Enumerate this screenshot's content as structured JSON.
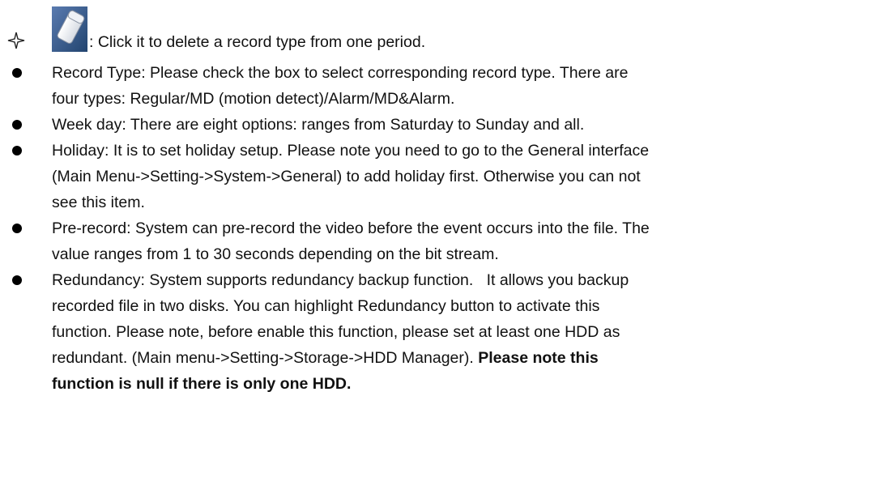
{
  "items": [
    {
      "marker": "diamond",
      "icon": "eraser-icon",
      "text": ": Click it to delete a record type from one period."
    },
    {
      "marker": "bullet",
      "line1": "Record Type: Please check the box to select corresponding record type. There are",
      "line2": "four types: Regular/MD (motion detect)/Alarm/MD&Alarm."
    },
    {
      "marker": "bullet",
      "line1": "Week day: There are eight options: ranges from Saturday to Sunday and all."
    },
    {
      "marker": "bullet",
      "line1": "Holiday: It is to set holiday setup. Please note you need to go to the General interface",
      "line2": "(Main Menu->Setting->System->General) to add holiday first. Otherwise you can not",
      "line3": "see this item."
    },
    {
      "marker": "bullet",
      "line1": "Pre-record: System can pre-record the video before the event occurs into the file. The",
      "line2": "value ranges from 1 to 30 seconds depending on the bit stream."
    },
    {
      "marker": "bullet",
      "line1": "Redundancy: System supports redundancy backup function.   It allows you backup",
      "line2": "recorded file in two disks. You can highlight Redundancy button to activate this",
      "line3": "function. Please note, before enable this function, please set at least one HDD as",
      "line4": "redundant. (Main menu->Setting->Storage->HDD Manager). ",
      "line4_bold": "Please note this",
      "line5_bold": "function is null if there is only one HDD."
    }
  ]
}
